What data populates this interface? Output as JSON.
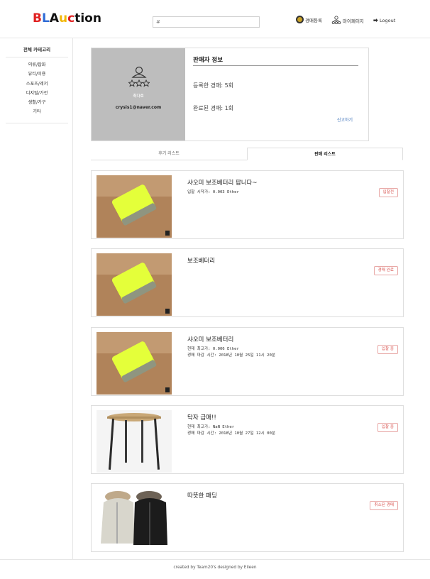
{
  "header": {
    "logo": [
      {
        "char": "B",
        "color": "#e02020"
      },
      {
        "char": "L",
        "color": "#2e6bd6"
      },
      {
        "char": "A",
        "color": "#111111"
      },
      {
        "char": "u",
        "color": "#f2b705"
      },
      {
        "char": "c",
        "color": "#e02020"
      },
      {
        "char": "t",
        "color": "#111111"
      },
      {
        "char": "i",
        "color": "#111111"
      },
      {
        "char": "o",
        "color": "#111111"
      },
      {
        "char": "n",
        "color": "#111111"
      }
    ],
    "search_placeholder": "#",
    "nav_register": "경매등록",
    "nav_mypage": "마이페이지",
    "nav_logout": "Logout"
  },
  "sidebar": {
    "title": "전체 카테고리",
    "items": [
      "의류/잡화",
      "뷰티/미용",
      "스포츠/레저",
      "디지털/가전",
      "생활/가구",
      "기타"
    ]
  },
  "seller": {
    "name": "최다호",
    "email": "crysis1@naver.com",
    "section_title": "판매자 정보",
    "registered": "등록한 경매: 5회",
    "completed": "완료된 경매: 1회",
    "report": "신고하기"
  },
  "tabs": {
    "review": "후기 리스트",
    "sales": "판매 리스트"
  },
  "listings": [
    {
      "title": "샤오미 보조베터리 팝니다~",
      "line1": "입찰 시작가: 0.003 Ether",
      "line2": "",
      "status": "입찰전",
      "image": "power-bank"
    },
    {
      "title": "보조베터리",
      "line1": "",
      "line2": "",
      "status": "경매 완료",
      "image": "power-bank"
    },
    {
      "title": "샤오미 보조베터리",
      "line1": "현재 최고가: 0.006 Ether",
      "line2": "경매 마감 시간: 2018년 10월 25일 11시 20분",
      "status": "입찰 중",
      "image": "power-bank"
    },
    {
      "title": "탁자 급매!!",
      "line1": "현재 최고가: NaN Ether",
      "line2": "경매 마감 시간: 2018년 10월 27일 12시 00분",
      "status": "입찰 중",
      "image": "table"
    },
    {
      "title": "따뜻한 패딩",
      "line1": "",
      "line2": "",
      "status": "취소된 경매",
      "image": "jackets"
    }
  ],
  "footer": "created by Team20's designed by Eileen"
}
